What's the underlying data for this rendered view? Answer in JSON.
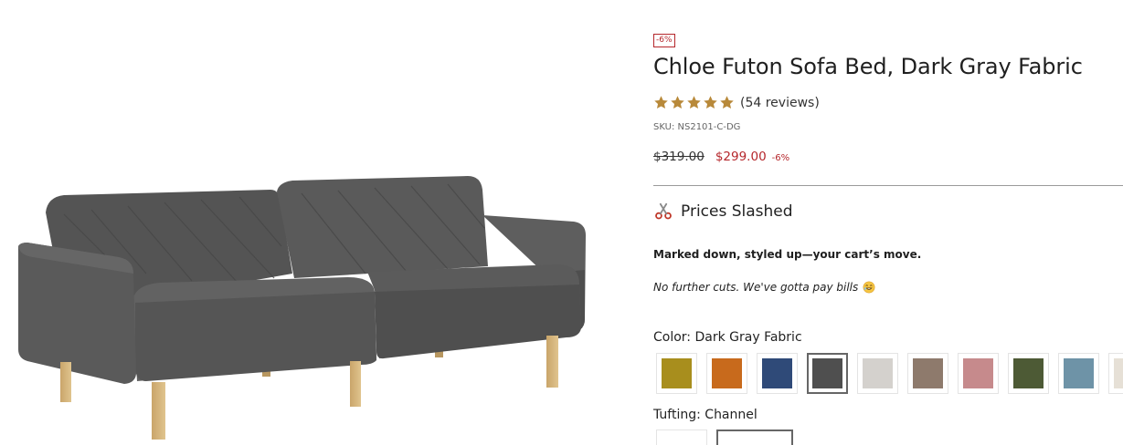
{
  "product": {
    "discount_badge": "-6%",
    "title": "Chloe Futon Sofa Bed, Dark Gray Fabric",
    "rating": 5,
    "reviews": "(54 reviews)",
    "sku": "SKU: NS2101-C-DG",
    "price_old": "$319.00",
    "price_new": "$299.00",
    "price_discount": "-6%",
    "image_alt": "Chloe futon sofa bed in dark gray fabric"
  },
  "promo": {
    "icon": "scissors-icon",
    "title": "Prices Slashed",
    "bold_text": "Marked down, styled up—your cart’s move.",
    "italic_text": "No further cuts. We've gotta pay bills",
    "emoji": "smiling-face-icon"
  },
  "options": {
    "color_label": "Color: Dark Gray Fabric",
    "colors": [
      {
        "name": "mustard",
        "hex": "#a88e1d"
      },
      {
        "name": "orange",
        "hex": "#c86a1c"
      },
      {
        "name": "navy",
        "hex": "#2f4a78"
      },
      {
        "name": "dark-gray",
        "hex": "#4f4f4f",
        "selected": true
      },
      {
        "name": "light-gray",
        "hex": "#d4d1cd"
      },
      {
        "name": "taupe",
        "hex": "#8e7a6c"
      },
      {
        "name": "rose",
        "hex": "#c68a8c"
      },
      {
        "name": "olive",
        "hex": "#4d5a35"
      },
      {
        "name": "slate-blue",
        "hex": "#6e93a7"
      },
      {
        "name": "cream",
        "hex": "#e6e0d6"
      }
    ],
    "tufting_label": "Tufting: Channel"
  },
  "colors": {
    "accent_red": "#b5262b",
    "star_gold": "#b8893a"
  }
}
